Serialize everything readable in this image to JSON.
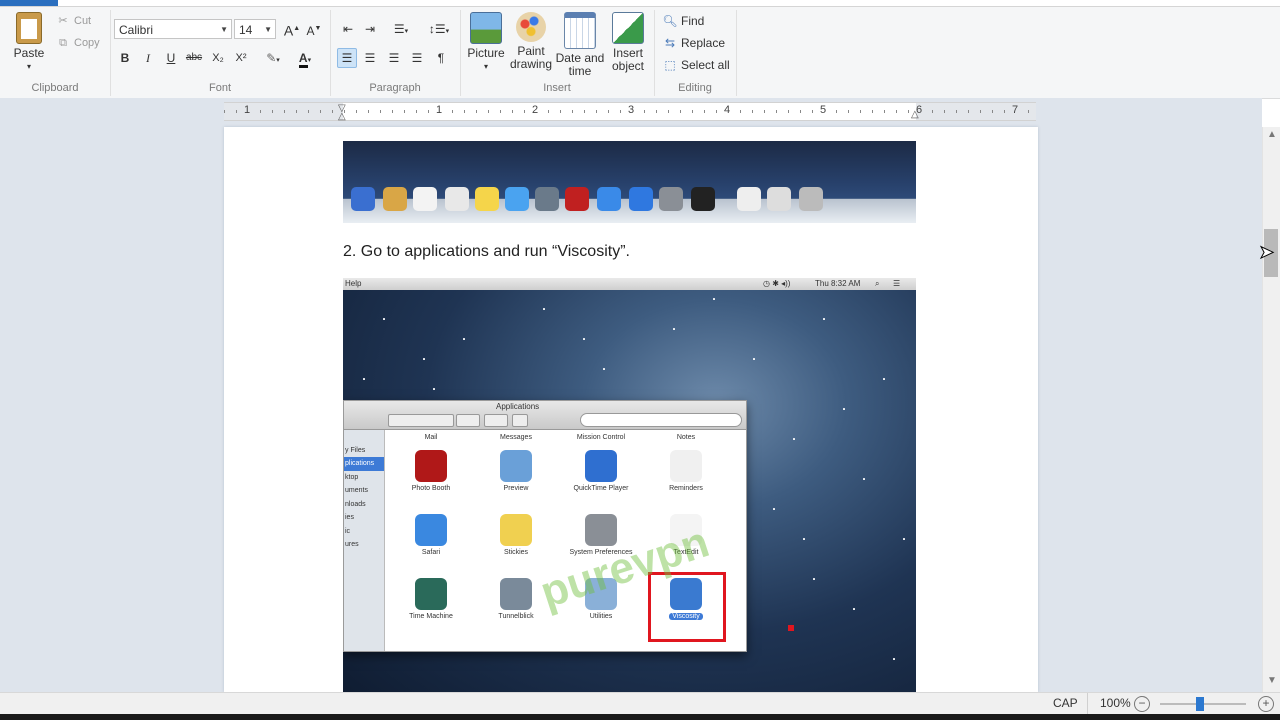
{
  "ribbon": {
    "clipboard": {
      "group_label": "Clipboard",
      "paste_label": "Paste",
      "cut_label": "Cut",
      "copy_label": "Copy"
    },
    "font": {
      "group_label": "Font",
      "font_name": "Calibri",
      "font_size": "14",
      "bold": "B",
      "italic": "I",
      "underline": "U",
      "strikethrough": "abc",
      "subscript": "X₂",
      "superscript": "X²"
    },
    "paragraph": {
      "group_label": "Paragraph"
    },
    "insert": {
      "group_label": "Insert",
      "picture": "Picture",
      "paint_line1": "Paint",
      "paint_line2": "drawing",
      "date_line1": "Date and",
      "date_line2": "time",
      "object_line1": "Insert",
      "object_line2": "object"
    },
    "editing": {
      "group_label": "Editing",
      "find": "Find",
      "replace": "Replace",
      "select_all": "Select all"
    }
  },
  "ruler": {
    "numbers": [
      "1",
      "1",
      "2",
      "3",
      "4",
      "5",
      "6",
      "7"
    ]
  },
  "document": {
    "step_text": "2. Go to applications and run “Viscosity”.",
    "mac_screenshot": {
      "menubar_left": "Help",
      "menubar_right": "Thu 8:32 AM",
      "finder_title": "Applications",
      "sidebar_items": [
        "",
        "y Files",
        "plications",
        "ktop",
        "uments",
        "nloads",
        "ies",
        "ic",
        "ures"
      ],
      "apps_row0": [
        "Mail",
        "Messages",
        "Mission Control",
        "Notes"
      ],
      "apps_row1": [
        "Photo Booth",
        "Preview",
        "QuickTime Player",
        "Reminders"
      ],
      "apps_row2": [
        "Safari",
        "Stickies",
        "System Preferences",
        "TextEdit"
      ],
      "apps_row3": [
        "Time Machine",
        "Tunnelblick",
        "Utilities",
        "Viscosity"
      ],
      "watermark": "purevpn"
    }
  },
  "statusbar": {
    "caps": "CAP",
    "zoom": "100%",
    "zoom_level": 1.0
  },
  "colors": {
    "accent": "#2b6fbf",
    "highlight": "#e0161f"
  }
}
